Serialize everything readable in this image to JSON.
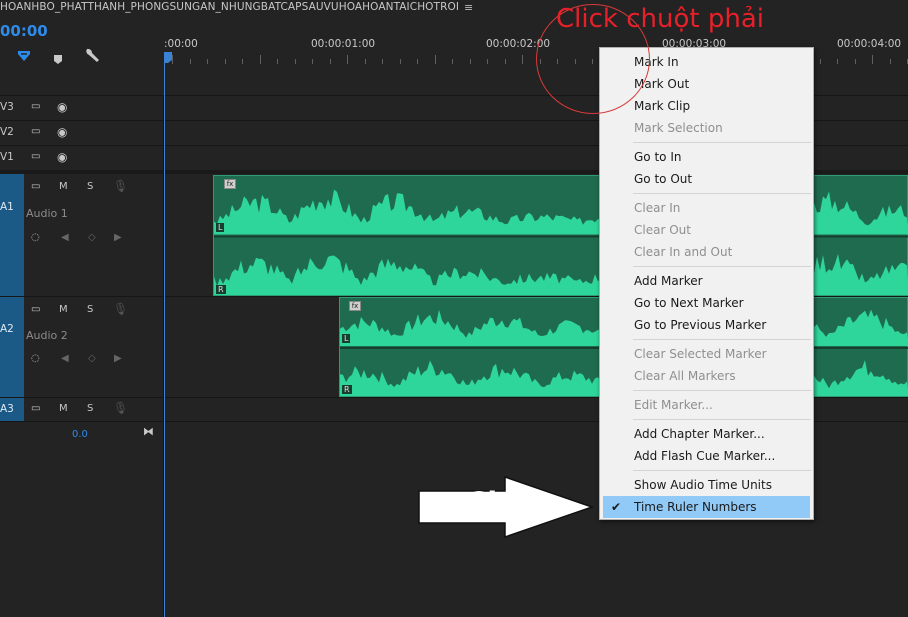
{
  "sequence": {
    "title": "HOANHBO_PHATTHANH_PHONGSUNGAN_NHUNGBATCAPSAUVUHOAHOANTAICHOTROI",
    "menu_icon": "≡",
    "timecode": "00:00"
  },
  "ruler": {
    "labels": [
      ":00:00",
      "00:00:01:00",
      "00:00:02:00",
      "00:00:03:00",
      "00:00:04:00"
    ]
  },
  "tracks": {
    "v3": "V3",
    "v2": "V2",
    "v1": "V1",
    "a1": "A1",
    "a1_name": "Audio 1",
    "a2": "A2",
    "a2_name": "Audio 2",
    "a3": "A3",
    "mute": "M",
    "solo": "S",
    "volume": "0.0",
    "left_channel": "L",
    "right_channel": "R",
    "fx": "fx"
  },
  "menu": {
    "mark_in": "Mark In",
    "mark_out": "Mark Out",
    "mark_clip": "Mark Clip",
    "mark_selection": "Mark Selection",
    "go_to_in": "Go to In",
    "go_to_out": "Go to Out",
    "clear_in": "Clear In",
    "clear_out": "Clear Out",
    "clear_in_out": "Clear In and Out",
    "add_marker": "Add Marker",
    "go_next_marker": "Go to Next Marker",
    "go_prev_marker": "Go to Previous Marker",
    "clear_selected_marker": "Clear Selected Marker",
    "clear_all_markers": "Clear All Markers",
    "edit_marker": "Edit Marker...",
    "add_chapter_marker": "Add Chapter Marker...",
    "add_flash_cue_marker": "Add Flash Cue Marker...",
    "show_audio_time_units": "Show Audio Time Units",
    "time_ruler_numbers": "Time Ruler Numbers"
  },
  "annotations": {
    "right_click": "Click chuột phải",
    "choose": "Chọn"
  },
  "colors": {
    "accent": "#2d8ceb",
    "waveform": "#2fd69b",
    "clip_bg": "#1f6b4f",
    "menu_highlight": "#91c9f7",
    "annotation_red": "#e8202a"
  }
}
